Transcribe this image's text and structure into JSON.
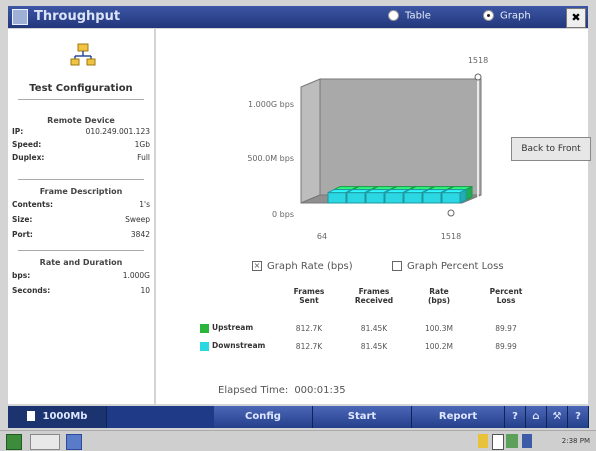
{
  "window": {
    "title": "Throughput",
    "close_label": "✖"
  },
  "view_options": [
    {
      "label": "Table",
      "selected": false
    },
    {
      "label": "Graph",
      "selected": true
    }
  ],
  "config_panel": {
    "title": "Test Configuration",
    "remote": {
      "heading": "Remote Device",
      "rows": [
        {
          "key": "IP:",
          "value": "010.249.001.123"
        },
        {
          "key": "Speed:",
          "value": "1Gb"
        },
        {
          "key": "Duplex:",
          "value": "Full"
        }
      ]
    },
    "frame": {
      "heading": "Frame Description",
      "rows": [
        {
          "key": "Contents:",
          "value": "1's"
        },
        {
          "key": "Size:",
          "value": "Sweep"
        },
        {
          "key": "Port:",
          "value": "3842"
        }
      ]
    },
    "rate": {
      "heading": "Rate and Duration",
      "rows": [
        {
          "key": "bps:",
          "value": "1.000G"
        },
        {
          "key": "Seconds:",
          "value": "10"
        }
      ]
    }
  },
  "chart_data": {
    "type": "bar",
    "ytick_labels": [
      "1.000G bps",
      "500.0M bps",
      "0 bps"
    ],
    "xtick_labels": [
      "64",
      "1518"
    ],
    "top_marker_label": "1518",
    "ylim": [
      0,
      1000000000
    ],
    "series": [
      {
        "name": "Upstream",
        "color": "#25d86a",
        "values": [
          100000000,
          100000000,
          100000000,
          100000000,
          100000000,
          100000000,
          100000000
        ]
      },
      {
        "name": "Downstream",
        "color": "#2bd7e3",
        "values": [
          100000000,
          100000000,
          100000000,
          100000000,
          100000000,
          100000000,
          100000000
        ]
      }
    ]
  },
  "back_to_front_label": "Back to Front",
  "graph_options": [
    {
      "label": "Graph Rate (bps)",
      "checked": true,
      "mark": "×"
    },
    {
      "label": "Graph Percent Loss",
      "checked": false,
      "mark": ""
    }
  ],
  "stats": {
    "headers": [
      {
        "line1": "Frames",
        "line2": "Sent"
      },
      {
        "line1": "Frames",
        "line2": "Received"
      },
      {
        "line1": "Rate",
        "line2": "(bps)"
      },
      {
        "line1": "Percent",
        "line2": "Loss"
      }
    ],
    "rows": [
      {
        "label": "Upstream",
        "color": "#2bb53b",
        "values": [
          "812.7K",
          "81.45K",
          "100.3M",
          "89.97"
        ]
      },
      {
        "label": "Downstream",
        "color": "#2bd7e3",
        "values": [
          "812.7K",
          "81.45K",
          "100.2M",
          "89.99"
        ]
      }
    ]
  },
  "elapsed": {
    "label": "Elapsed Time:",
    "value": "000:01:35"
  },
  "bottom_bar": {
    "link_label": "1000Mb",
    "config_label": "Config",
    "start_label": "Start",
    "report_label": "Report",
    "help_label": "?",
    "extra_help_label": "?"
  },
  "taskbar": {
    "clock": "2:38 PM"
  }
}
